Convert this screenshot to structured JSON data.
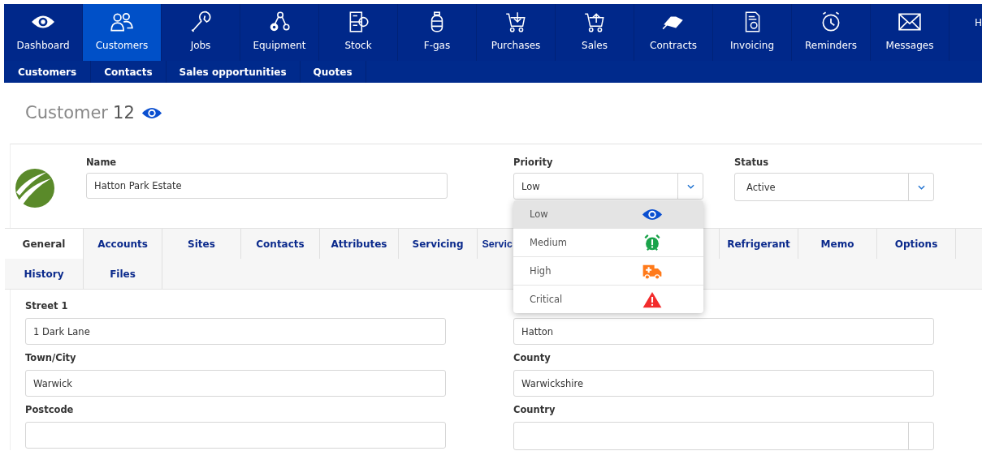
{
  "nav": [
    {
      "label": "Dashboard",
      "selected": false
    },
    {
      "label": "Customers",
      "selected": true
    },
    {
      "label": "Jobs",
      "selected": false
    },
    {
      "label": "Equipment",
      "selected": false
    },
    {
      "label": "Stock",
      "selected": false
    },
    {
      "label": "F-gas",
      "selected": false
    },
    {
      "label": "Purchases",
      "selected": false
    },
    {
      "label": "Sales",
      "selected": false
    },
    {
      "label": "Contracts",
      "selected": false
    },
    {
      "label": "Invoicing",
      "selected": false
    },
    {
      "label": "Reminders",
      "selected": false
    },
    {
      "label": "Messages",
      "selected": false
    },
    {
      "label": "H",
      "selected": false
    }
  ],
  "subnav": [
    "Customers",
    "Contacts",
    "Sales opportunities",
    "Quotes"
  ],
  "page_title": {
    "title": "Customer",
    "number": "12"
  },
  "header": {
    "name_label": "Name",
    "name": "Hatton Park Estate",
    "priority_label": "Priority",
    "priority": "Low",
    "status_label": "Status",
    "status": "Active"
  },
  "tabs": [
    [
      {
        "kind": "tab",
        "label": "General",
        "selected": true
      },
      {
        "kind": "tab",
        "label": "Accounts",
        "selected": false
      },
      {
        "kind": "tab",
        "label": "Sites",
        "selected": false
      },
      {
        "kind": "tab",
        "label": "Contacts",
        "selected": false
      },
      {
        "kind": "tab",
        "label": "Attributes",
        "selected": false
      },
      {
        "kind": "tab",
        "label": "Servicing",
        "selected": false
      },
      {
        "kind": "covered",
        "label": "Servic",
        "selected": false
      },
      {
        "kind": "tab",
        "label": "Refrigerant",
        "selected": false
      },
      {
        "kind": "tab",
        "label": "Memo",
        "selected": false
      },
      {
        "kind": "tab",
        "label": "Options",
        "selected": false
      }
    ],
    [
      {
        "kind": "tab",
        "label": "History",
        "selected": false
      },
      {
        "kind": "tab",
        "label": "Files",
        "selected": false
      }
    ]
  ],
  "fields": [
    {
      "label": "Street 1",
      "value": "1 Dark Lane"
    },
    {
      "value": "Hatton"
    },
    {
      "label": "Town/City",
      "value": "Warwick"
    },
    {
      "label": "County",
      "value": "Warwickshire"
    },
    {
      "label": "Postcode"
    },
    {
      "label": "Country",
      "kind": "select"
    }
  ],
  "priority_options": [
    {
      "label": "Low",
      "selected": true,
      "kind": "eye",
      "color": "#0a4fd0"
    },
    {
      "label": "Medium",
      "selected": false,
      "kind": "alarm",
      "color": "#1aa34a"
    },
    {
      "label": "High",
      "selected": false,
      "kind": "ambulance",
      "color": "#ff7a1a"
    },
    {
      "label": "Critical",
      "selected": false,
      "kind": "warning",
      "color": "#f22b2b"
    }
  ]
}
